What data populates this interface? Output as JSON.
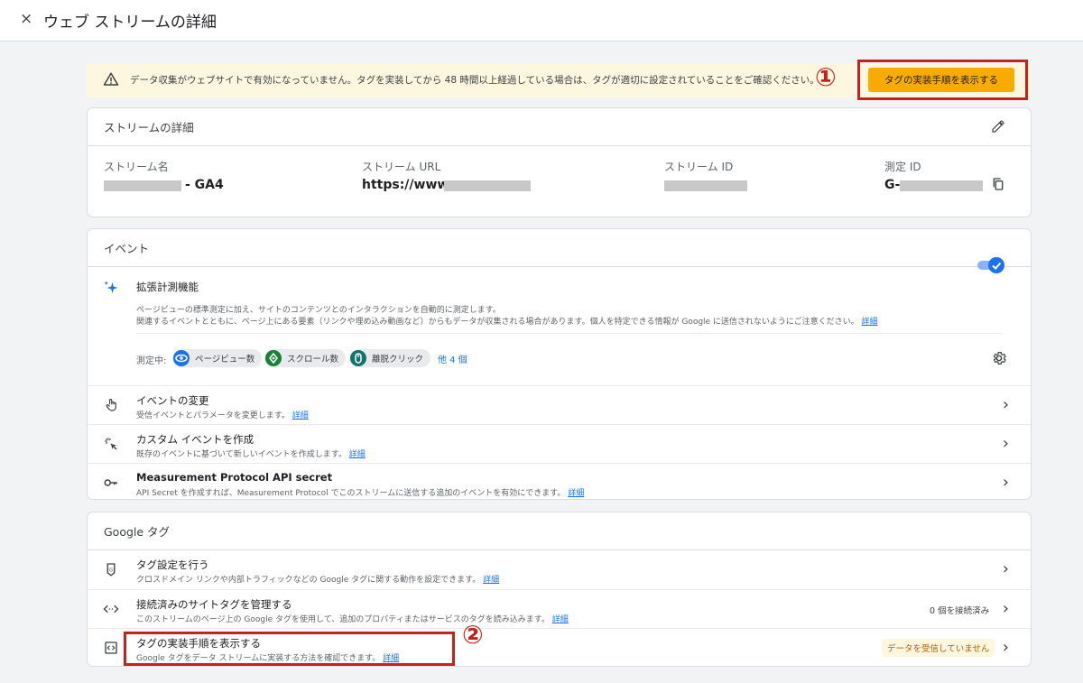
{
  "header": {
    "close_glyph": "×",
    "title": "ウェブ ストリームの詳細"
  },
  "banner": {
    "text": "データ収集がウェブサイトで有効になっていません。タグを実装してから 48 時間以上経過している場合は、タグが適切に設定されていることをご確認ください。",
    "button": "タグの実装手順を表示する",
    "annotation": "①"
  },
  "stream": {
    "title": "ストリームの詳細",
    "name_label": "ストリーム名",
    "name_value": "- GA4",
    "url_label": "ストリーム URL",
    "url_value": "https://www.",
    "id_label": "ストリーム ID",
    "mid_label": "測定 ID",
    "mid_value": "G-"
  },
  "events": {
    "title": "イベント",
    "enhanced": {
      "title": "拡張計測機能",
      "line1": "ページビューの標準測定に加え、サイトのコンテンツとのインタラクションを自動的に測定します。",
      "line2": "関連するイベントとともに、ページ上にある要素（リンクや埋め込み動画など）からもデータが収集される場合があります。個人を特定できる情報が Google に送信されないようにご注意ください。",
      "detail": "詳細",
      "measuring_label": "測定中:",
      "chips": [
        "ページビュー数",
        "スクロール数",
        "離脱クリック"
      ],
      "more": "他 4 個",
      "toggle_on": true
    },
    "rows": [
      {
        "title": "イベントの変更",
        "sub": "受信イベントとパラメータを変更します。",
        "detail": "詳細"
      },
      {
        "title": "カスタム イベントを作成",
        "sub": "既存のイベントに基づいて新しいイベントを作成します。",
        "detail": "詳細"
      },
      {
        "title": "Measurement Protocol API secret",
        "sub": "API Secret を作成すれば、Measurement Protocol でこのストリームに送信する追加のイベントを有効にできます。",
        "detail": "詳細"
      }
    ]
  },
  "gtag": {
    "title": "Google タグ",
    "rows": [
      {
        "title": "タグ設定を行う",
        "sub": "クロスドメイン リンクや内部トラフィックなどの Google タグに関する動作を設定できます。",
        "detail": "詳細"
      },
      {
        "title": "接続済みのサイトタグを管理する",
        "sub": "このストリームのページ上の Google タグを使用して、追加のプロパティまたはサービスのタグを読み込みます。",
        "detail": "詳細",
        "status": "0 個を接続済み"
      },
      {
        "title": "タグの実装手順を表示する",
        "sub": "Google タグをデータ ストリームに実装する方法を確認できます。",
        "detail": "詳細",
        "status": "データを受信していません"
      }
    ],
    "annotation": "②"
  },
  "chevron": "›",
  "colors": {
    "accent": "#1a73e8",
    "button": "#f9ab00",
    "annotation": "#c5221f",
    "banner_bg": "#fef7e0"
  }
}
